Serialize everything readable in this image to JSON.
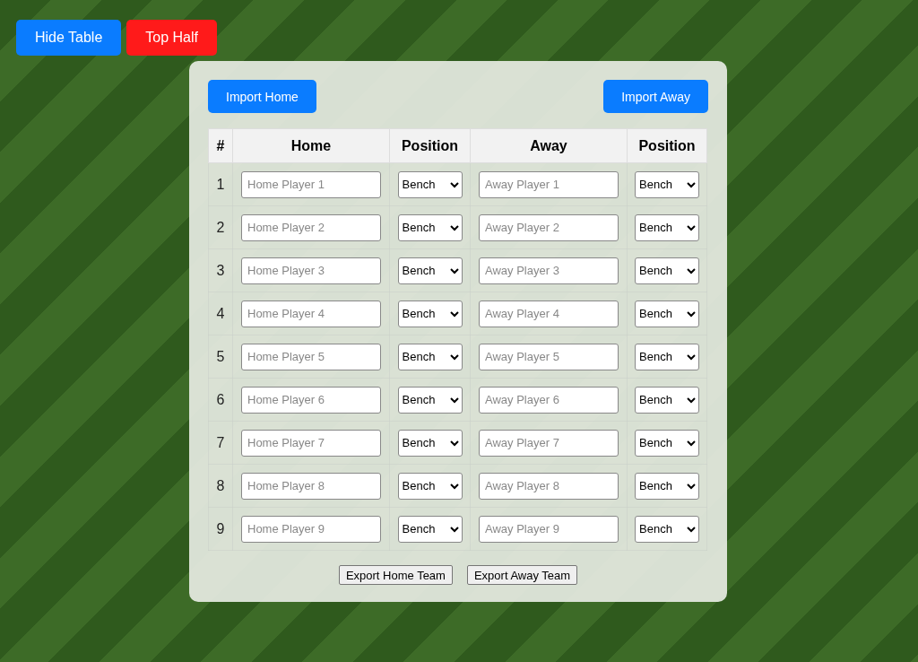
{
  "top_buttons": [
    {
      "label": "Hide Table",
      "kind": "primary"
    },
    {
      "label": "Top Half",
      "kind": "danger"
    }
  ],
  "import_buttons": [
    "Import Home",
    "Import Away"
  ],
  "table": {
    "columns": [
      "#",
      "Home",
      "Position",
      "Away",
      "Position"
    ],
    "rows": [
      {
        "number": "1",
        "home_placeholder": "Home Player 1",
        "home_position": "Bench",
        "away_placeholder": "Away Player 1",
        "away_position": "Bench"
      },
      {
        "number": "2",
        "home_placeholder": "Home Player 2",
        "home_position": "Bench",
        "away_placeholder": "Away Player 2",
        "away_position": "Bench"
      },
      {
        "number": "3",
        "home_placeholder": "Home Player 3",
        "home_position": "Bench",
        "away_placeholder": "Away Player 3",
        "away_position": "Bench"
      },
      {
        "number": "4",
        "home_placeholder": "Home Player 4",
        "home_position": "Bench",
        "away_placeholder": "Away Player 4",
        "away_position": "Bench"
      },
      {
        "number": "5",
        "home_placeholder": "Home Player 5",
        "home_position": "Bench",
        "away_placeholder": "Away Player 5",
        "away_position": "Bench"
      },
      {
        "number": "6",
        "home_placeholder": "Home Player 6",
        "home_position": "Bench",
        "away_placeholder": "Away Player 6",
        "away_position": "Bench"
      },
      {
        "number": "7",
        "home_placeholder": "Home Player 7",
        "home_position": "Bench",
        "away_placeholder": "Away Player 7",
        "away_position": "Bench"
      },
      {
        "number": "8",
        "home_placeholder": "Home Player 8",
        "home_position": "Bench",
        "away_placeholder": "Away Player 8",
        "away_position": "Bench"
      },
      {
        "number": "9",
        "home_placeholder": "Home Player 9",
        "home_position": "Bench",
        "away_placeholder": "Away Player 9",
        "away_position": "Bench"
      }
    ]
  },
  "export_buttons": [
    "Export Home Team",
    "Export Away Team"
  ]
}
